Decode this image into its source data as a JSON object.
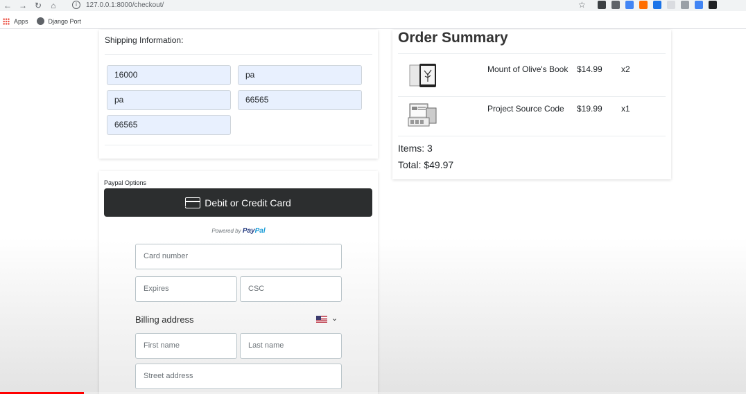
{
  "browser": {
    "url": "127.0.0.1:8000/checkout/",
    "bookmarks": [
      {
        "label": "Apps",
        "icon": "apps-grid-icon"
      },
      {
        "label": "Django Port",
        "icon": "globe-icon"
      }
    ],
    "extension_colors": [
      "#3c4043",
      "#5f6368",
      "#4285f4",
      "#ff6d00",
      "#1a73e8",
      "#dadce0",
      "#9aa0a6",
      "#4285f4",
      "#202124"
    ]
  },
  "shipping": {
    "title": "Shipping Information:",
    "fields": [
      "16000",
      "pa",
      "pa",
      "66565",
      "66565"
    ]
  },
  "order": {
    "title": "Order Summary",
    "items": [
      {
        "name": "Mount of Olive's Book",
        "price": "$14.99",
        "qty": "x2",
        "icon": "book-thumbnail"
      },
      {
        "name": "Project Source Code",
        "price": "$19.99",
        "qty": "x1",
        "icon": "screens-thumbnail"
      }
    ],
    "items_total": "Items: 3",
    "grand_total": "Total: $49.97"
  },
  "paypal": {
    "title": "Paypal Options",
    "card_button": "Debit or Credit Card",
    "powered_by": "Powered by",
    "brand_a": "Pay",
    "brand_b": "Pal",
    "card_number_placeholder": "Card number",
    "expires_placeholder": "Expires",
    "csc_placeholder": "CSC",
    "billing_label": "Billing address",
    "first_name_placeholder": "First name",
    "last_name_placeholder": "Last name",
    "street_placeholder": "Street address"
  },
  "video": {
    "progress_fraction": 0.112
  }
}
